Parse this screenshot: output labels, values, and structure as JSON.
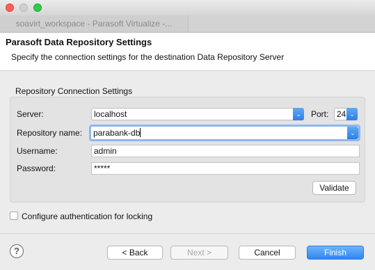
{
  "window": {
    "tab_title": "soavirt_workspace - Parasoft Virtualize -..."
  },
  "header": {
    "title": "Parasoft Data Repository Settings",
    "description": "Specify the connection settings for the destination Data Repository Server"
  },
  "connection": {
    "group_title": "Repository Connection Settings",
    "server_label": "Server:",
    "server_value": "localhost",
    "port_label": "Port:",
    "port_value": "24",
    "repo_label": "Repository name:",
    "repo_value": "parabank-db",
    "username_label": "Username:",
    "username_value": "admin",
    "password_label": "Password:",
    "password_value": "*****",
    "validate_label": "Validate"
  },
  "locking": {
    "label": "Configure authentication for locking",
    "checked": false
  },
  "footer": {
    "help": "?",
    "back": "< Back",
    "next": "Next >",
    "cancel": "Cancel",
    "finish": "Finish"
  }
}
